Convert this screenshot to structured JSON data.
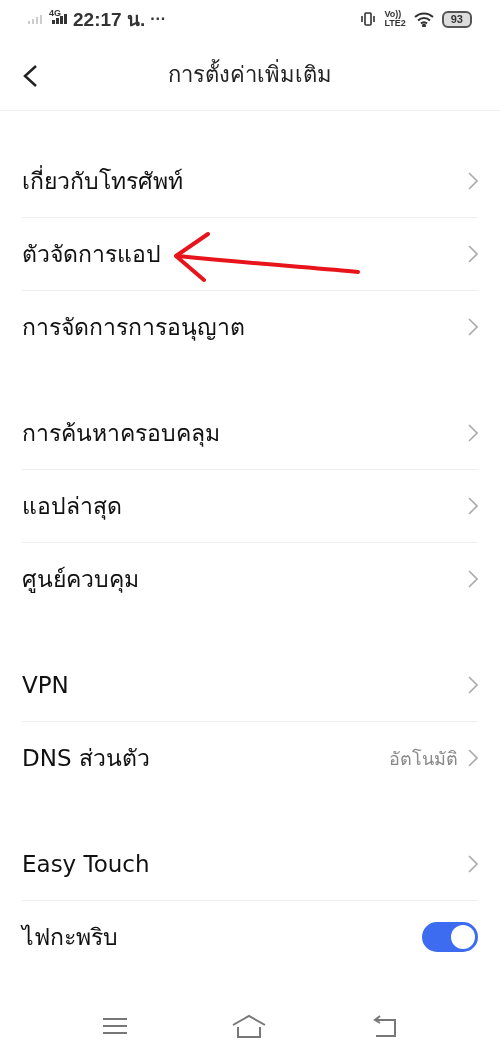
{
  "status_bar": {
    "network": "4G",
    "time": "22:17 น.",
    "more": "···",
    "volte_top": "Vo))",
    "volte_bottom": "LTE2",
    "battery": "93"
  },
  "header": {
    "title": "การตั้งค่าเพิ่มเติม"
  },
  "sections": [
    {
      "items": [
        {
          "kind": "link",
          "label": "เกี่ยวกับโทรศัพท์"
        },
        {
          "kind": "link",
          "label": "ตัวจัดการแอป"
        },
        {
          "kind": "link",
          "label": "การจัดการการอนุญาต"
        }
      ]
    },
    {
      "items": [
        {
          "kind": "link",
          "label": "การค้นหาครอบคลุม"
        },
        {
          "kind": "link",
          "label": "แอปล่าสุด"
        },
        {
          "kind": "link",
          "label": "ศูนย์ควบคุม"
        }
      ]
    },
    {
      "items": [
        {
          "kind": "link",
          "label": "VPN"
        },
        {
          "kind": "link",
          "label": "DNS ส่วนตัว",
          "value": "อัตโนมัติ"
        }
      ]
    },
    {
      "items": [
        {
          "kind": "link",
          "label": "Easy Touch"
        },
        {
          "kind": "toggle",
          "label": "ไฟกะพริบ",
          "on": true
        }
      ]
    }
  ]
}
